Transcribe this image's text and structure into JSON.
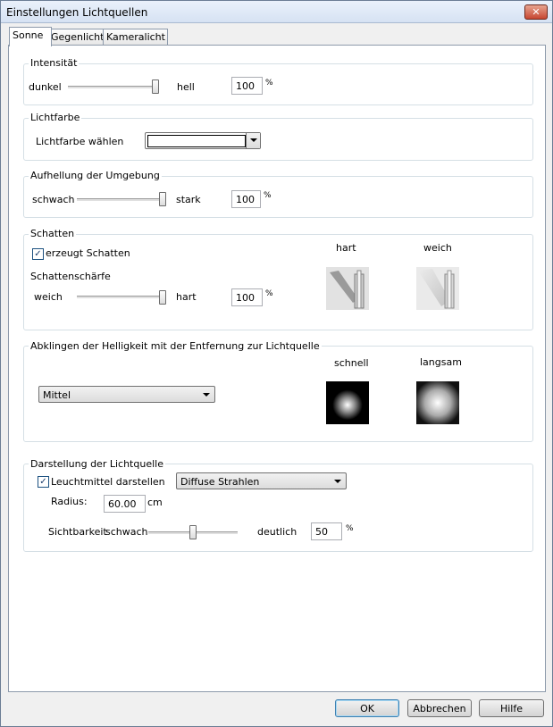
{
  "window": {
    "title": "Einstellungen Lichtquellen",
    "close_glyph": "✕"
  },
  "tabs": [
    {
      "label": "Sonne"
    },
    {
      "label": "Gegenlicht"
    },
    {
      "label": "Kameralicht"
    }
  ],
  "intensity": {
    "group_label": "Intensität",
    "min_label": "dunkel",
    "max_label": "hell",
    "value": "100",
    "unit": "%",
    "level": 100
  },
  "light_color": {
    "group_label": "Lichtfarbe",
    "label": "Lichtfarbe wählen",
    "selected": ""
  },
  "ambient": {
    "group_label": "Aufhellung der Umgebung",
    "min_label": "schwach",
    "max_label": "stark",
    "value": "100",
    "unit": "%",
    "level": 100
  },
  "shadow": {
    "group_label": "Schatten",
    "cast_label": "erzeugt Schatten",
    "cast_checked": true,
    "sharpness_label": "Schattenschärfe",
    "min_label": "weich",
    "max_label": "hart",
    "value": "100",
    "unit": "%",
    "level": 100,
    "preview_hard_label": "hart",
    "preview_soft_label": "weich"
  },
  "falloff": {
    "group_label": "Abklingen der Helligkeit mit der Entfernung zur Lichtquelle",
    "selected": "Mittel",
    "preview_fast_label": "schnell",
    "preview_slow_label": "langsam"
  },
  "source_display": {
    "group_label": "Darstellung der Lichtquelle",
    "show_label": "Leuchtmittel darstellen",
    "show_checked": true,
    "mode_selected": "Diffuse Strahlen",
    "radius_label": "Radius:",
    "radius_value": "60.00",
    "radius_unit": "cm",
    "visibility_label": "Sichtbarkeit",
    "min_label": "schwach",
    "max_label": "deutlich",
    "value": "50",
    "unit": "%",
    "level": 50
  },
  "buttons": {
    "ok": "OK",
    "cancel": "Abbrechen",
    "help": "Hilfe"
  },
  "colors": {
    "titlebar": "#dbe6f4",
    "panel": "#ffffff",
    "dialog": "#f0f0f0",
    "close": "#c74631"
  },
  "check_glyph": "✓"
}
